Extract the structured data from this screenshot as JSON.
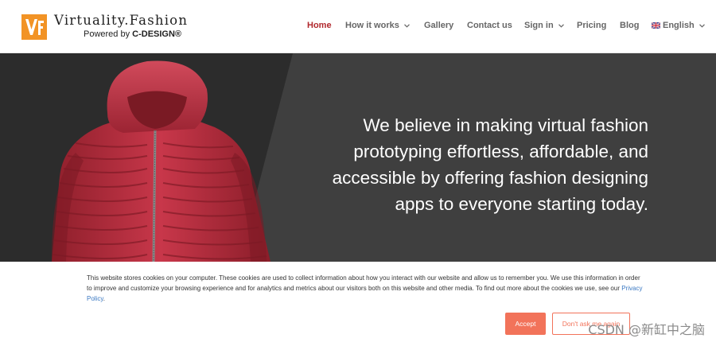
{
  "brand": {
    "name": "Virtuality.Fashion",
    "tagline_prefix": "Powered by ",
    "tagline_brand": "C-DESIGN®",
    "accent_color": "#f29325"
  },
  "nav": {
    "items": [
      {
        "label": "Home",
        "active": true
      },
      {
        "label": "How it works",
        "dropdown": true
      },
      {
        "label": "Gallery"
      },
      {
        "label": "Contact us"
      },
      {
        "label": "Sign in",
        "dropdown": true
      },
      {
        "label": "Pricing"
      },
      {
        "label": "Blog"
      },
      {
        "label": "English",
        "dropdown": true,
        "icon": "uk-flag-icon"
      }
    ],
    "active_color": "#b1282d"
  },
  "hero": {
    "headline": "We believe in making virtual fashion prototyping effortless, affordable, and accessible by offering fashion designing apps to everyone starting today.",
    "background_color": "#3f3f3f",
    "image": "red-puffer-jacket"
  },
  "cookie_banner": {
    "text": "This website stores cookies on your computer. These cookies are used to collect information about how you interact with our website and allow us to remember you. We use this information in order to improve and customize your browsing experience and for analytics and metrics about our visitors both on this website and other media. To find out more about the cookies we use, see our ",
    "link_label": "Privacy Policy",
    "text_end": ".",
    "accept_label": "Accept",
    "decline_label": "Don't ask me again",
    "button_color": "#f2735a"
  },
  "watermark": "CSDN @新缸中之脑"
}
